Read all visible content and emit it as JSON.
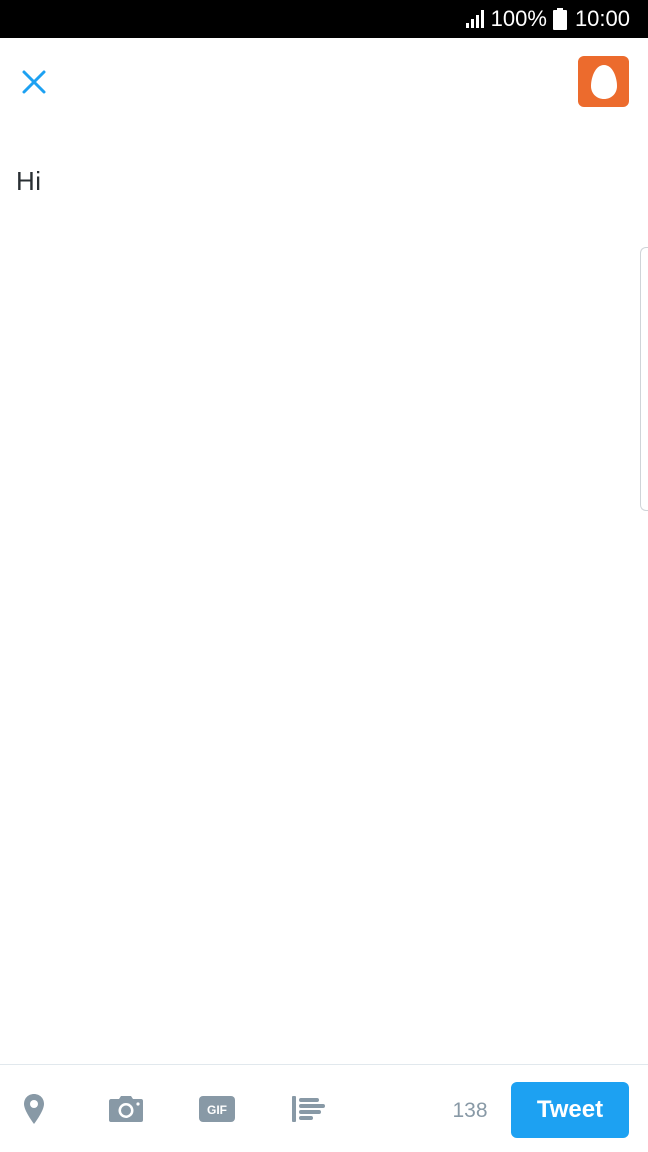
{
  "status_bar": {
    "battery_percent": "100%",
    "time": "10:00"
  },
  "compose": {
    "text": "Hi"
  },
  "toolbar": {
    "gif_label": "GIF",
    "char_count": "138",
    "tweet_label": "Tweet"
  },
  "colors": {
    "accent": "#1da1f2",
    "avatar_bg": "#ec6b2d",
    "icon_gray": "#8899a6"
  },
  "icons": {
    "close": "close-icon",
    "avatar": "egg-avatar-icon",
    "location": "location-pin-icon",
    "camera": "camera-icon",
    "gif": "gif-icon",
    "poll": "poll-icon",
    "signal": "signal-icon",
    "battery": "battery-icon"
  }
}
